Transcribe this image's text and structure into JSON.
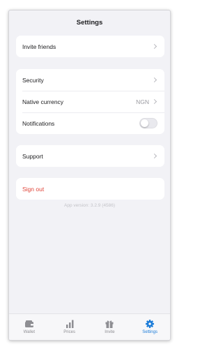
{
  "header": {
    "title": "Settings"
  },
  "groups": {
    "invite": {
      "label": "Invite friends"
    },
    "security": {
      "label": "Security"
    },
    "currency": {
      "label": "Native currency",
      "value": "NGN"
    },
    "notifications": {
      "label": "Notifications",
      "enabled": false
    },
    "support": {
      "label": "Support"
    },
    "signout": {
      "label": "Sign out",
      "color": "#e0453a"
    }
  },
  "version": "App version: 3.2.9 (4586)",
  "tabbar": {
    "active_color": "#1a7bd8",
    "tabs": [
      {
        "label": "Wallet",
        "icon": "wallet-icon",
        "active": false
      },
      {
        "label": "Prices",
        "icon": "bar-chart-icon",
        "active": false
      },
      {
        "label": "Invite",
        "icon": "gift-icon",
        "active": false
      },
      {
        "label": "Settings",
        "icon": "gear-icon",
        "active": true
      }
    ]
  }
}
